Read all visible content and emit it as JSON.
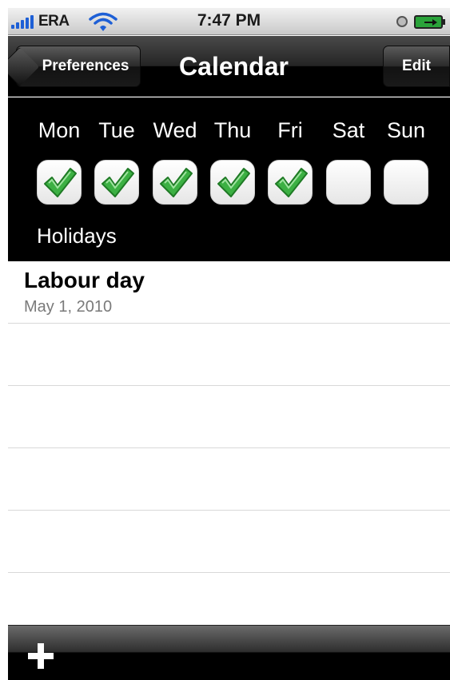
{
  "status_bar": {
    "carrier": "ERA",
    "time": "7:47 PM",
    "icons": [
      "signal-icon",
      "wifi-icon",
      "alarm-clock-icon",
      "battery-charging-icon"
    ]
  },
  "nav": {
    "back_label": "Preferences",
    "title": "Calendar",
    "edit_label": "Edit"
  },
  "days": [
    {
      "label": "Mon",
      "checked": true
    },
    {
      "label": "Tue",
      "checked": true
    },
    {
      "label": "Wed",
      "checked": true
    },
    {
      "label": "Thu",
      "checked": true
    },
    {
      "label": "Fri",
      "checked": true
    },
    {
      "label": "Sat",
      "checked": false
    },
    {
      "label": "Sun",
      "checked": false
    }
  ],
  "section_header": "Holidays",
  "holidays": [
    {
      "name": "Labour day",
      "date": "May 1, 2010"
    }
  ],
  "toolbar": {
    "add_icon": "plus-icon"
  },
  "colors": {
    "checkmark": "#3cb043",
    "signal": "#1d5fd6",
    "nav_background": "#000000"
  }
}
